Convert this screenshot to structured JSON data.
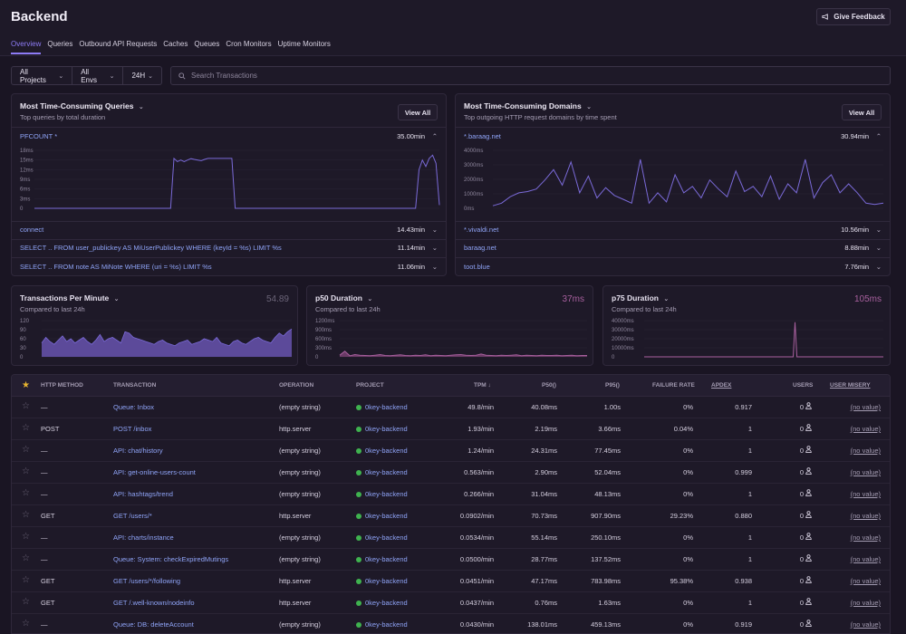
{
  "page": {
    "title": "Backend",
    "feedback_label": "Give Feedback"
  },
  "tabs": [
    "Overview",
    "Queries",
    "Outbound API Requests",
    "Caches",
    "Queues",
    "Cron Monitors",
    "Uptime Monitors"
  ],
  "filters": {
    "project": "All Projects",
    "env": "All Envs",
    "period": "24H",
    "search_placeholder": "Search Transactions"
  },
  "queries_panel": {
    "title": "Most Time-Consuming Queries",
    "subtitle": "Top queries by total duration",
    "view_all": "View All",
    "expanded": {
      "label": "PFCOUNT *",
      "value": "35.00min"
    },
    "rows": [
      {
        "label": "connect",
        "value": "14.43min"
      },
      {
        "label": "SELECT .. FROM user_publickey AS MiUserPublickey WHERE (keyId = %s) LIMIT %s",
        "value": "11.14min"
      },
      {
        "label": "SELECT .. FROM note AS MiNote WHERE (uri = %s) LIMIT %s",
        "value": "11.06min"
      }
    ],
    "chart_data": {
      "type": "line",
      "y_ticks": [
        "18ms",
        "15ms",
        "12ms",
        "9ms",
        "6ms",
        "3ms",
        "0"
      ],
      "ylim": [
        0,
        18
      ],
      "values": [
        0,
        0,
        0,
        0,
        0,
        0,
        0,
        0,
        0,
        0,
        0,
        0,
        0,
        0,
        0,
        0,
        0,
        0,
        0,
        0,
        0,
        0,
        0,
        0,
        0,
        0,
        0,
        0,
        0,
        0,
        0,
        0,
        0,
        0,
        0,
        0,
        0,
        0,
        0,
        0,
        0,
        15.5,
        14.5,
        15,
        14.5,
        15,
        15.4,
        15.2,
        15,
        14.8,
        15.2,
        15.5,
        15.5,
        15.5,
        15.5,
        15.5,
        15.5,
        15.5,
        15.5,
        0,
        0,
        0,
        0,
        0,
        0,
        0,
        0,
        0,
        0,
        0,
        0,
        0,
        0,
        0,
        0,
        0,
        0,
        0,
        0,
        0,
        0,
        0,
        0,
        0,
        0,
        0,
        0,
        0,
        0,
        0,
        0,
        0,
        0,
        0,
        0,
        0,
        0,
        0,
        0,
        0,
        0,
        0,
        0,
        0,
        0,
        0,
        0,
        0,
        0,
        0,
        0,
        0,
        0,
        12,
        15,
        13,
        15.5,
        16.5,
        14,
        1
      ]
    }
  },
  "domains_panel": {
    "title": "Most Time-Consuming Domains",
    "subtitle": "Top outgoing HTTP request domains by time spent",
    "view_all": "View All",
    "expanded": {
      "label": "*.baraag.net",
      "value": "30.94min"
    },
    "rows": [
      {
        "label": "*.vivaldi.net",
        "value": "10.56min"
      },
      {
        "label": "baraag.net",
        "value": "8.88min"
      },
      {
        "label": "toot.blue",
        "value": "7.76min"
      }
    ],
    "chart_data": {
      "type": "line",
      "y_ticks": [
        "4000ms",
        "3000ms",
        "2000ms",
        "1000ms",
        "0ms"
      ],
      "ylim": [
        0,
        4500
      ],
      "values": [
        200,
        400,
        900,
        1200,
        1300,
        1500,
        2200,
        3000,
        1800,
        3600,
        1200,
        2500,
        800,
        1600,
        1000,
        700,
        400,
        3800,
        400,
        1200,
        500,
        2600,
        1200,
        1700,
        800,
        2200,
        1500,
        900,
        2900,
        1300,
        1700,
        900,
        2500,
        700,
        1900,
        1200,
        3800,
        800,
        2000,
        2600,
        1200,
        1900,
        1200,
        400,
        300,
        400
      ]
    }
  },
  "tpm_panel": {
    "title": "Transactions Per Minute",
    "subtitle": "Compared to last 24h",
    "value": "54.89",
    "chart_data": {
      "type": "area",
      "y_ticks": [
        "120",
        "90",
        "60",
        "30",
        "0"
      ],
      "ylim": [
        0,
        130
      ],
      "values": [
        50,
        70,
        55,
        45,
        60,
        75,
        55,
        65,
        50,
        60,
        70,
        55,
        45,
        60,
        80,
        55,
        65,
        70,
        60,
        50,
        90,
        85,
        70,
        65,
        60,
        55,
        50,
        45,
        55,
        60,
        50,
        45,
        40,
        50,
        55,
        60,
        45,
        50,
        55,
        65,
        60,
        55,
        70,
        50,
        45,
        40,
        55,
        60,
        50,
        45,
        55,
        65,
        70,
        60,
        55,
        50,
        70,
        85,
        75,
        90,
        100
      ]
    }
  },
  "p50_panel": {
    "title": "p50 Duration",
    "subtitle": "Compared to last 24h",
    "value": "37ms",
    "chart_data": {
      "type": "line",
      "y_ticks": [
        "1200ms",
        "900ms",
        "600ms",
        "300ms",
        "0"
      ],
      "ylim": [
        0,
        1300
      ],
      "values": [
        60,
        200,
        40,
        80,
        60,
        50,
        40,
        60,
        80,
        50,
        40,
        60,
        70,
        50,
        40,
        60,
        50,
        70,
        40,
        60,
        50,
        40,
        60,
        70,
        80,
        60,
        50,
        60,
        100,
        60,
        50,
        40,
        60,
        50,
        60,
        70,
        40,
        60,
        50,
        40,
        60,
        50,
        50,
        60,
        40,
        50,
        60,
        40,
        50,
        50
      ]
    }
  },
  "p75_panel": {
    "title": "p75 Duration",
    "subtitle": "Compared to last 24h",
    "value": "105ms",
    "chart_data": {
      "type": "line",
      "y_ticks": [
        "40000ms",
        "30000ms",
        "20000ms",
        "10000ms",
        "0"
      ],
      "ylim": [
        0,
        44000
      ],
      "values": [
        0,
        0,
        0,
        0,
        0,
        0,
        0,
        0,
        0,
        0,
        0,
        0,
        0,
        0,
        0,
        0,
        0,
        0,
        0,
        0,
        0,
        0,
        0,
        0,
        0,
        0,
        0,
        0,
        0,
        0,
        0,
        0,
        0,
        0,
        0,
        0,
        0,
        0,
        0,
        0,
        0,
        0,
        0,
        0,
        0,
        0,
        0,
        0,
        0,
        0,
        0,
        0,
        0,
        0,
        0,
        0,
        0,
        0,
        0,
        0,
        0,
        0,
        0,
        0,
        0,
        0,
        0,
        0,
        0,
        0,
        0,
        0,
        0,
        0,
        0,
        0,
        0,
        0,
        0,
        0,
        0,
        0,
        42000,
        0,
        0,
        0,
        0,
        0,
        0,
        0,
        0,
        0,
        0,
        0,
        0,
        0,
        0,
        0,
        0,
        0,
        0,
        0,
        0,
        0,
        0,
        0,
        0,
        0,
        0,
        0,
        0,
        0,
        0,
        0,
        0,
        0,
        0,
        0,
        0,
        0,
        0,
        0,
        0,
        0,
        0,
        0,
        0,
        0,
        0,
        0,
        0
      ]
    }
  },
  "table": {
    "headers": [
      "HTTP METHOD",
      "TRANSACTION",
      "OPERATION",
      "PROJECT",
      "TPM",
      "P50()",
      "P95()",
      "FAILURE RATE",
      "APDEX",
      "USERS",
      "USER MISERY"
    ],
    "rows": [
      {
        "method": "—",
        "transaction": "Queue: Inbox",
        "operation": "(empty string)",
        "project": "0key-backend",
        "tpm": "49.8/min",
        "p50": "40.08ms",
        "p95": "1.00s",
        "failure": "0%",
        "apdex": "0.917",
        "users": "0",
        "misery": "(no value)"
      },
      {
        "method": "POST",
        "transaction": "POST /inbox",
        "operation": "http.server",
        "project": "0key-backend",
        "tpm": "1.93/min",
        "p50": "2.19ms",
        "p95": "3.66ms",
        "failure": "0.04%",
        "apdex": "1",
        "users": "0",
        "misery": "(no value)"
      },
      {
        "method": "—",
        "transaction": "API: chat/history",
        "operation": "(empty string)",
        "project": "0key-backend",
        "tpm": "1.24/min",
        "p50": "24.31ms",
        "p95": "77.45ms",
        "failure": "0%",
        "apdex": "1",
        "users": "0",
        "misery": "(no value)"
      },
      {
        "method": "—",
        "transaction": "API: get-online-users-count",
        "operation": "(empty string)",
        "project": "0key-backend",
        "tpm": "0.563/min",
        "p50": "2.90ms",
        "p95": "52.04ms",
        "failure": "0%",
        "apdex": "0.999",
        "users": "0",
        "misery": "(no value)"
      },
      {
        "method": "—",
        "transaction": "API: hashtags/trend",
        "operation": "(empty string)",
        "project": "0key-backend",
        "tpm": "0.266/min",
        "p50": "31.04ms",
        "p95": "48.13ms",
        "failure": "0%",
        "apdex": "1",
        "users": "0",
        "misery": "(no value)"
      },
      {
        "method": "GET",
        "transaction": "GET /users/*",
        "operation": "http.server",
        "project": "0key-backend",
        "tpm": "0.0902/min",
        "p50": "70.73ms",
        "p95": "907.90ms",
        "failure": "29.23%",
        "apdex": "0.880",
        "users": "0",
        "misery": "(no value)"
      },
      {
        "method": "—",
        "transaction": "API: charts/instance",
        "operation": "(empty string)",
        "project": "0key-backend",
        "tpm": "0.0534/min",
        "p50": "55.14ms",
        "p95": "250.10ms",
        "failure": "0%",
        "apdex": "1",
        "users": "0",
        "misery": "(no value)"
      },
      {
        "method": "—",
        "transaction": "Queue: System: checkExpiredMutings",
        "operation": "(empty string)",
        "project": "0key-backend",
        "tpm": "0.0500/min",
        "p50": "28.77ms",
        "p95": "137.52ms",
        "failure": "0%",
        "apdex": "1",
        "users": "0",
        "misery": "(no value)"
      },
      {
        "method": "GET",
        "transaction": "GET /users/*/following",
        "operation": "http.server",
        "project": "0key-backend",
        "tpm": "0.0451/min",
        "p50": "47.17ms",
        "p95": "783.98ms",
        "failure": "95.38%",
        "apdex": "0.938",
        "users": "0",
        "misery": "(no value)"
      },
      {
        "method": "GET",
        "transaction": "GET /.well-known/nodeinfo",
        "operation": "http.server",
        "project": "0key-backend",
        "tpm": "0.0437/min",
        "p50": "0.76ms",
        "p95": "1.63ms",
        "failure": "0%",
        "apdex": "1",
        "users": "0",
        "misery": "(no value)"
      },
      {
        "method": "—",
        "transaction": "Queue: DB: deleteAccount",
        "operation": "(empty string)",
        "project": "0key-backend",
        "tpm": "0.0430/min",
        "p50": "138.01ms",
        "p95": "459.13ms",
        "failure": "0%",
        "apdex": "0.919",
        "users": "0",
        "misery": "(no value)"
      }
    ]
  },
  "colors": {
    "accent": "#8d7bf5",
    "link": "#8fa4f7",
    "bg": "#1a1523",
    "panel": "#1e1928",
    "purple_value": "#a8609e"
  }
}
